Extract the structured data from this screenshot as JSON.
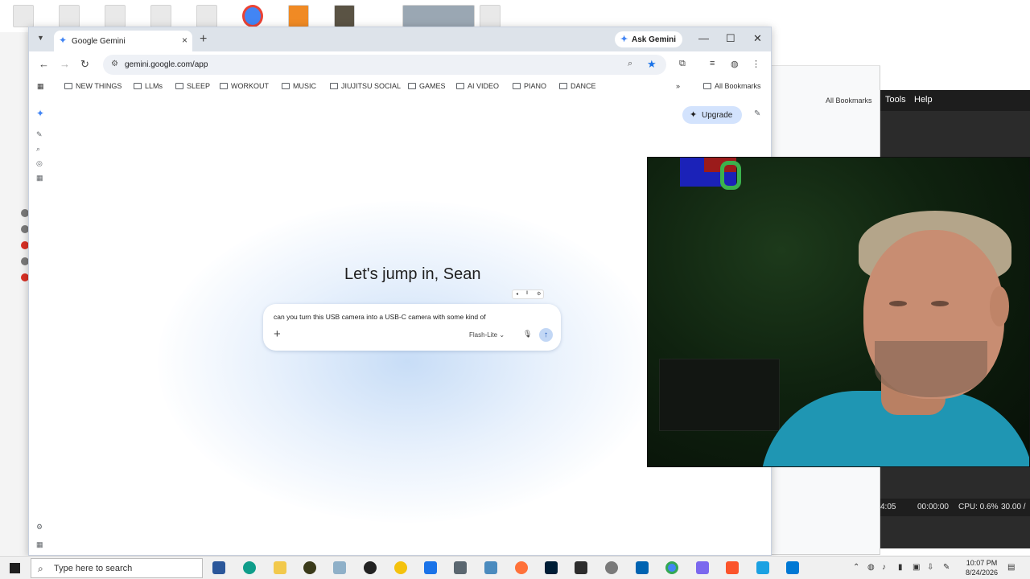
{
  "browser": {
    "tab_title": "Google Gemini",
    "tab_close_glyph": "×",
    "new_tab_glyph": "+",
    "ask_gemini_label": "Ask Gemini",
    "url": "gemini.google.com/app",
    "bookmarks": [
      "NEW THINGS",
      "LLMs",
      "SLEEP",
      "WORKOUT",
      "MUSIC",
      "JIUJITSU SOCIAL",
      "GAMES",
      "AI VIDEO",
      "PIANO",
      "DANCE"
    ],
    "overflow_glyph": "»",
    "all_bookmarks_label": "All Bookmarks"
  },
  "gemini": {
    "upgrade_label": "Upgrade",
    "greeting": "Let's jump in, Sean",
    "prompt_text": "can you turn this USB camera into a USB-C camera with some kind of",
    "add_glyph": "+",
    "model_label": "Flash-Lite",
    "model_chevron": "⌄",
    "send_glyph": "↑"
  },
  "background_windows": {
    "right_all_bookmarks": "All Bookmarks",
    "menu_tools": "Tools",
    "menu_help": "Help",
    "status_time_left": "4:05",
    "status_time": "00:00:00",
    "status_cpu": "CPU: 0.6%",
    "status_fps": "30.00 /"
  },
  "taskbar": {
    "search_placeholder": "Type here to search",
    "time": "10:07 PM",
    "date": "8/24/2026"
  },
  "colors": {
    "accent": "#1a73e8",
    "upgrade_bg": "#d3e3fd",
    "tabbar_bg": "#dde3ea"
  },
  "icons": {
    "tab_favicon": "gemini-sparkle-icon",
    "back": "back-arrow-icon",
    "forward": "forward-arrow-icon",
    "reload": "reload-icon",
    "bookmark": "star-icon",
    "folder": "folder-icon"
  }
}
